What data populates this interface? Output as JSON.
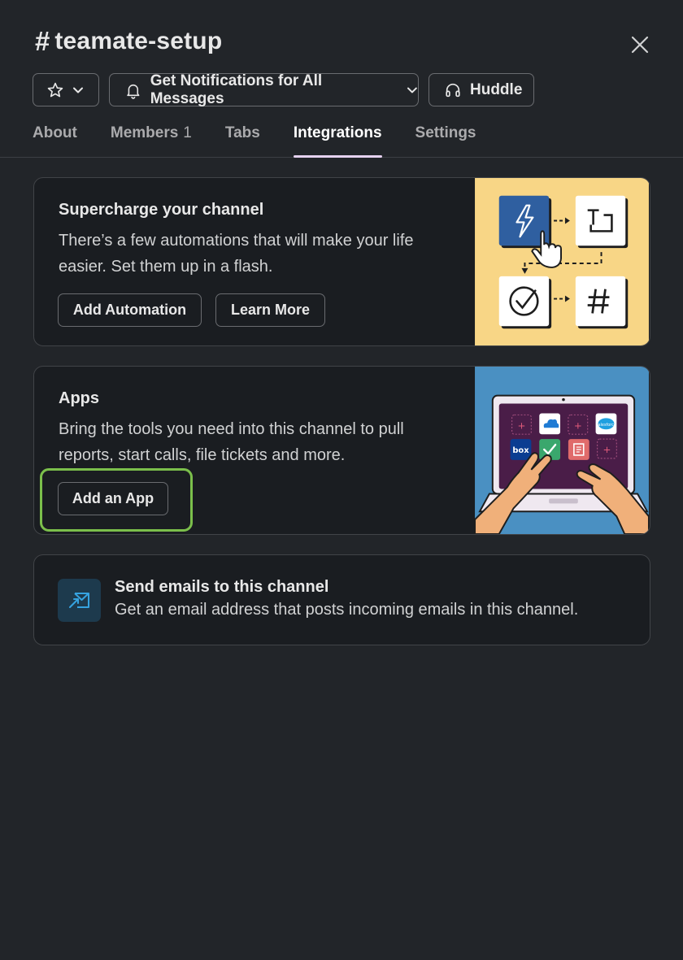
{
  "header": {
    "hash": "#",
    "title": "teamate-setup"
  },
  "header_buttons": {
    "notifications_label": "Get Notifications for All Messages",
    "huddle_label": "Huddle"
  },
  "tabs": [
    {
      "label": "About"
    },
    {
      "label": "Members",
      "count": "1"
    },
    {
      "label": "Tabs"
    },
    {
      "label": "Integrations",
      "active": true
    },
    {
      "label": "Settings"
    }
  ],
  "cards": {
    "automation": {
      "title": "Supercharge your channel",
      "text_line1": "There’s a few automations that will make your life",
      "text_line2": "easier. Set them up in a flash.",
      "primary_button": "Add Automation",
      "secondary_button": "Learn More"
    },
    "apps": {
      "title": "Apps",
      "text_line1": "Bring the tools you need into this channel to pull",
      "text_line2": "reports, start calls, file tickets and more.",
      "button": "Add an App",
      "logo_box": "box",
      "logo_salesforce": "salesforce"
    },
    "email": {
      "title": "Send emails to this channel",
      "text": "Get an email address that posts incoming emails in this channel."
    }
  },
  "colors": {
    "background": "#222529",
    "card_background": "#1a1d21",
    "focus_ring": "#7bbf4b",
    "active_tab_underline": "#e6d2f0",
    "automation_illustration_bg": "#f8d686",
    "apps_illustration_bg": "#4a90c2"
  }
}
